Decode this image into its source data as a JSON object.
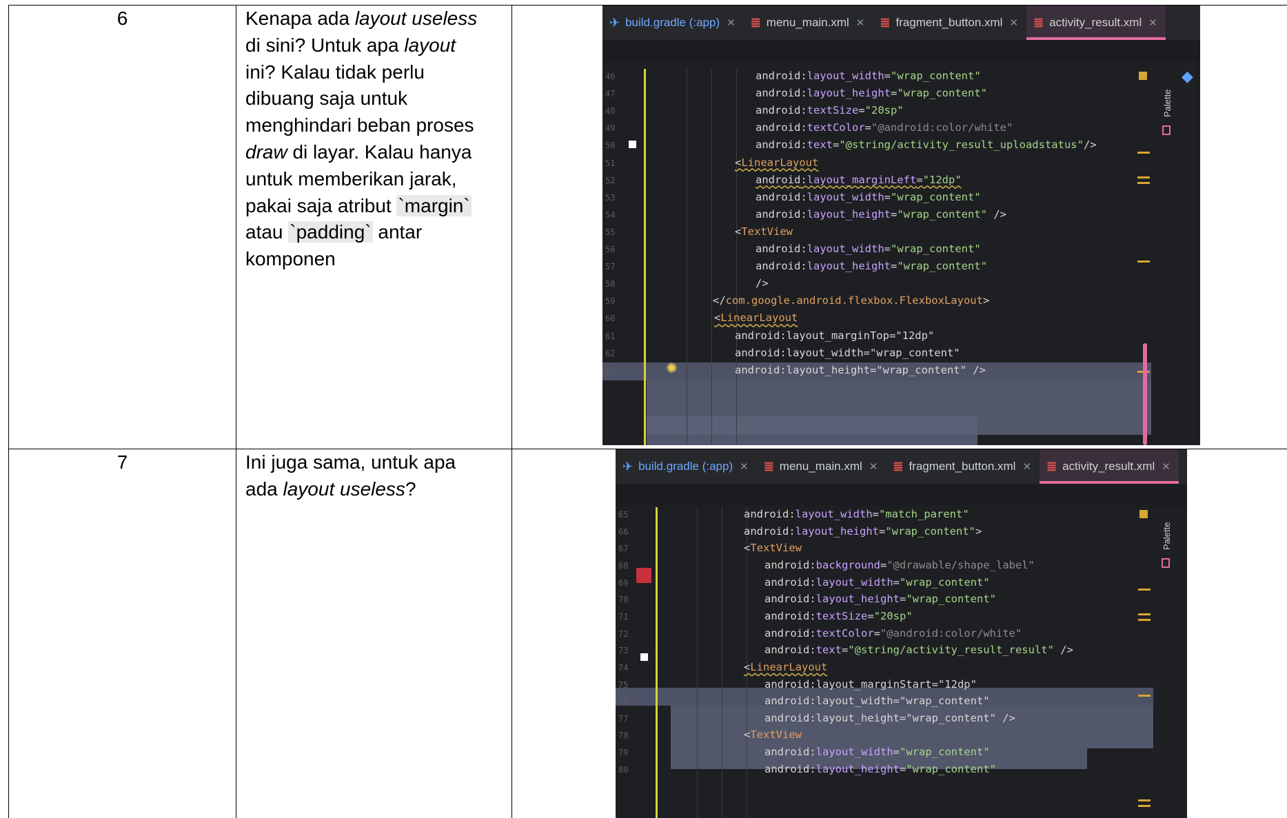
{
  "rows": [
    {
      "number": "6",
      "comment_parts": [
        {
          "t": "Kenapa ada "
        },
        {
          "t": "layout useless",
          "i": true
        },
        {
          "t": "\ndi sini? Untuk apa "
        },
        {
          "t": "layout",
          "i": true
        },
        {
          "t": "\nini? Kalau tidak perlu\ndibuang saja untuk\nmenghindari beban proses\n"
        },
        {
          "t": "draw",
          "i": true
        },
        {
          "t": " di layar. Kalau hanya\nuntuk memberikan jarak,\npakai saja atribut "
        },
        {
          "t": "`margin`",
          "c": true
        },
        {
          "t": "\natau "
        },
        {
          "t": "`padding`",
          "c": true
        },
        {
          "t": " antar\nkomponen"
        }
      ],
      "screenshot": {
        "tabs": [
          "build.gradle (:app)",
          "menu_main.xml",
          "fragment_button.xml",
          "activity_result.xml"
        ],
        "side_label": "Palette",
        "lines": [
          {
            "n": "46",
            "code": [
              [
                "ns",
                "android"
              ],
              [
                "q",
                ":"
              ],
              [
                "attr",
                "layout_width"
              ],
              [
                "q",
                "="
              ],
              [
                "val",
                "\"wrap_content\""
              ]
            ]
          },
          {
            "n": "47",
            "code": [
              [
                "ns",
                "android"
              ],
              [
                "q",
                ":"
              ],
              [
                "attr",
                "layout_height"
              ],
              [
                "q",
                "="
              ],
              [
                "val",
                "\"wrap_content\""
              ]
            ]
          },
          {
            "n": "48",
            "code": [
              [
                "ns",
                "android"
              ],
              [
                "q",
                ":"
              ],
              [
                "attr",
                "textSize"
              ],
              [
                "q",
                "="
              ],
              [
                "val",
                "\"20sp\""
              ]
            ]
          },
          {
            "n": "49",
            "code": [
              [
                "ns",
                "android"
              ],
              [
                "q",
                ":"
              ],
              [
                "attr",
                "textColor"
              ],
              [
                "q",
                "="
              ],
              [
                "valg",
                "\"@android:color/white\""
              ]
            ]
          },
          {
            "n": "50",
            "code": [
              [
                "ns",
                "android"
              ],
              [
                "q",
                ":"
              ],
              [
                "attr",
                "text"
              ],
              [
                "q",
                "="
              ],
              [
                "val",
                "\"@string/activity_result_uploadstatus\""
              ],
              [
                "q",
                "/>"
              ]
            ]
          },
          {
            "n": "51",
            "code": [
              [
                "q",
                "<"
              ],
              [
                "tag",
                "LinearLayout"
              ]
            ]
          },
          {
            "n": "52",
            "code": [
              [
                "ns",
                "android"
              ],
              [
                "q",
                ":"
              ],
              [
                "attr",
                "layout_marginLeft"
              ],
              [
                "q",
                "="
              ],
              [
                "val",
                "\"12dp\""
              ]
            ]
          },
          {
            "n": "53",
            "code": [
              [
                "ns",
                "android"
              ],
              [
                "q",
                ":"
              ],
              [
                "attr",
                "layout_width"
              ],
              [
                "q",
                "="
              ],
              [
                "val",
                "\"wrap_content\""
              ]
            ]
          },
          {
            "n": "54",
            "code": [
              [
                "ns",
                "android"
              ],
              [
                "q",
                ":"
              ],
              [
                "attr",
                "layout_height"
              ],
              [
                "q",
                "="
              ],
              [
                "val",
                "\"wrap_content\""
              ],
              [
                "q",
                " />"
              ]
            ]
          },
          {
            "n": "55",
            "code": [
              [
                "q",
                "<"
              ],
              [
                "tag",
                "TextView"
              ]
            ]
          },
          {
            "n": "56",
            "code": [
              [
                "ns",
                "android"
              ],
              [
                "q",
                ":"
              ],
              [
                "attr",
                "layout_width"
              ],
              [
                "q",
                "="
              ],
              [
                "val",
                "\"wrap_content\""
              ]
            ]
          },
          {
            "n": "57",
            "code": [
              [
                "ns",
                "android"
              ],
              [
                "q",
                ":"
              ],
              [
                "attr",
                "layout_height"
              ],
              [
                "q",
                "="
              ],
              [
                "val",
                "\"wrap_content\""
              ]
            ]
          },
          {
            "n": "58",
            "code": [
              [
                "q",
                "/>"
              ]
            ]
          },
          {
            "n": "59",
            "code": [
              [
                "q",
                "</"
              ],
              [
                "tag",
                "com.google.android.flexbox.FlexboxLayout"
              ],
              [
                "q",
                ">"
              ]
            ]
          },
          {
            "n": "60",
            "code": [
              [
                "q",
                "<"
              ],
              [
                "tag",
                "LinearLayout"
              ]
            ]
          },
          {
            "n": "61",
            "code": [
              [
                "ns",
                "android:layout_marginTop=\"12dp\""
              ]
            ]
          },
          {
            "n": "62",
            "code": [
              [
                "ns",
                "android:layout_width=\"wrap_content\""
              ]
            ]
          },
          {
            "n": "63",
            "code": [
              [
                "ns",
                "android:layout_height=\"wrap_content\" />"
              ]
            ]
          }
        ]
      }
    },
    {
      "number": "7",
      "comment_parts": [
        {
          "t": "Ini juga sama, untuk apa\nada "
        },
        {
          "t": "layout useless",
          "i": true
        },
        {
          "t": "?"
        }
      ],
      "screenshot": {
        "tabs": [
          "build.gradle (:app)",
          "menu_main.xml",
          "fragment_button.xml",
          "activity_result.xml"
        ],
        "side_label": "Palette",
        "lines": [
          {
            "n": "65",
            "code": [
              [
                "ns",
                "android"
              ],
              [
                "q",
                ":"
              ],
              [
                "attr",
                "layout_width"
              ],
              [
                "q",
                "="
              ],
              [
                "val",
                "\"match_parent\""
              ]
            ]
          },
          {
            "n": "66",
            "code": [
              [
                "ns",
                "android"
              ],
              [
                "q",
                ":"
              ],
              [
                "attr",
                "layout_height"
              ],
              [
                "q",
                "="
              ],
              [
                "val",
                "\"wrap_content\""
              ],
              [
                "q",
                ">"
              ]
            ]
          },
          {
            "n": "67",
            "code": [
              [
                "q",
                "<"
              ],
              [
                "tag",
                "TextView"
              ]
            ]
          },
          {
            "n": "68",
            "code": [
              [
                "ns",
                "android"
              ],
              [
                "q",
                ":"
              ],
              [
                "attr",
                "background"
              ],
              [
                "q",
                "="
              ],
              [
                "valg",
                "\"@drawable/shape_label\""
              ]
            ]
          },
          {
            "n": "69",
            "code": [
              [
                "ns",
                "android"
              ],
              [
                "q",
                ":"
              ],
              [
                "attr",
                "layout_width"
              ],
              [
                "q",
                "="
              ],
              [
                "val",
                "\"wrap_content\""
              ]
            ]
          },
          {
            "n": "70",
            "code": [
              [
                "ns",
                "android"
              ],
              [
                "q",
                ":"
              ],
              [
                "attr",
                "layout_height"
              ],
              [
                "q",
                "="
              ],
              [
                "val",
                "\"wrap_content\""
              ]
            ]
          },
          {
            "n": "71",
            "code": [
              [
                "ns",
                "android"
              ],
              [
                "q",
                ":"
              ],
              [
                "attr",
                "textSize"
              ],
              [
                "q",
                "="
              ],
              [
                "val",
                "\"20sp\""
              ]
            ]
          },
          {
            "n": "72",
            "code": [
              [
                "ns",
                "android"
              ],
              [
                "q",
                ":"
              ],
              [
                "attr",
                "textColor"
              ],
              [
                "q",
                "="
              ],
              [
                "valg",
                "\"@android:color/white\""
              ]
            ]
          },
          {
            "n": "73",
            "code": [
              [
                "ns",
                "android"
              ],
              [
                "q",
                ":"
              ],
              [
                "attr",
                "text"
              ],
              [
                "q",
                "="
              ],
              [
                "val",
                "\"@string/activity_result_result\""
              ],
              [
                "q",
                " />"
              ]
            ]
          },
          {
            "n": "74",
            "code": [
              [
                "q",
                "<"
              ],
              [
                "tag",
                "LinearLayout"
              ]
            ]
          },
          {
            "n": "75",
            "code": [
              [
                "ns",
                "android:layout_marginStart=\"12dp\""
              ]
            ]
          },
          {
            "n": "76",
            "code": [
              [
                "ns",
                "android:layout_width=\"wrap_content\""
              ]
            ]
          },
          {
            "n": "77",
            "code": [
              [
                "ns",
                "android:layout_height=\"wrap_content\" />"
              ]
            ]
          },
          {
            "n": "78",
            "code": [
              [
                "q",
                "<"
              ],
              [
                "tag",
                "TextView"
              ]
            ]
          },
          {
            "n": "79",
            "code": [
              [
                "ns",
                "android"
              ],
              [
                "q",
                ":"
              ],
              [
                "attr",
                "layout_width"
              ],
              [
                "q",
                "="
              ],
              [
                "val",
                "\"wrap_content\""
              ]
            ]
          },
          {
            "n": "80",
            "code": [
              [
                "ns",
                "android"
              ],
              [
                "q",
                ":"
              ],
              [
                "attr",
                "layout_height"
              ],
              [
                "q",
                "="
              ],
              [
                "val",
                "\"wrap_content\""
              ]
            ]
          }
        ]
      }
    }
  ],
  "icons": {
    "gradle": "gradle-icon",
    "xml": "xml-file-icon",
    "close": "close-icon",
    "bulb": "lightbulb-icon",
    "palette": "palette-icon"
  }
}
